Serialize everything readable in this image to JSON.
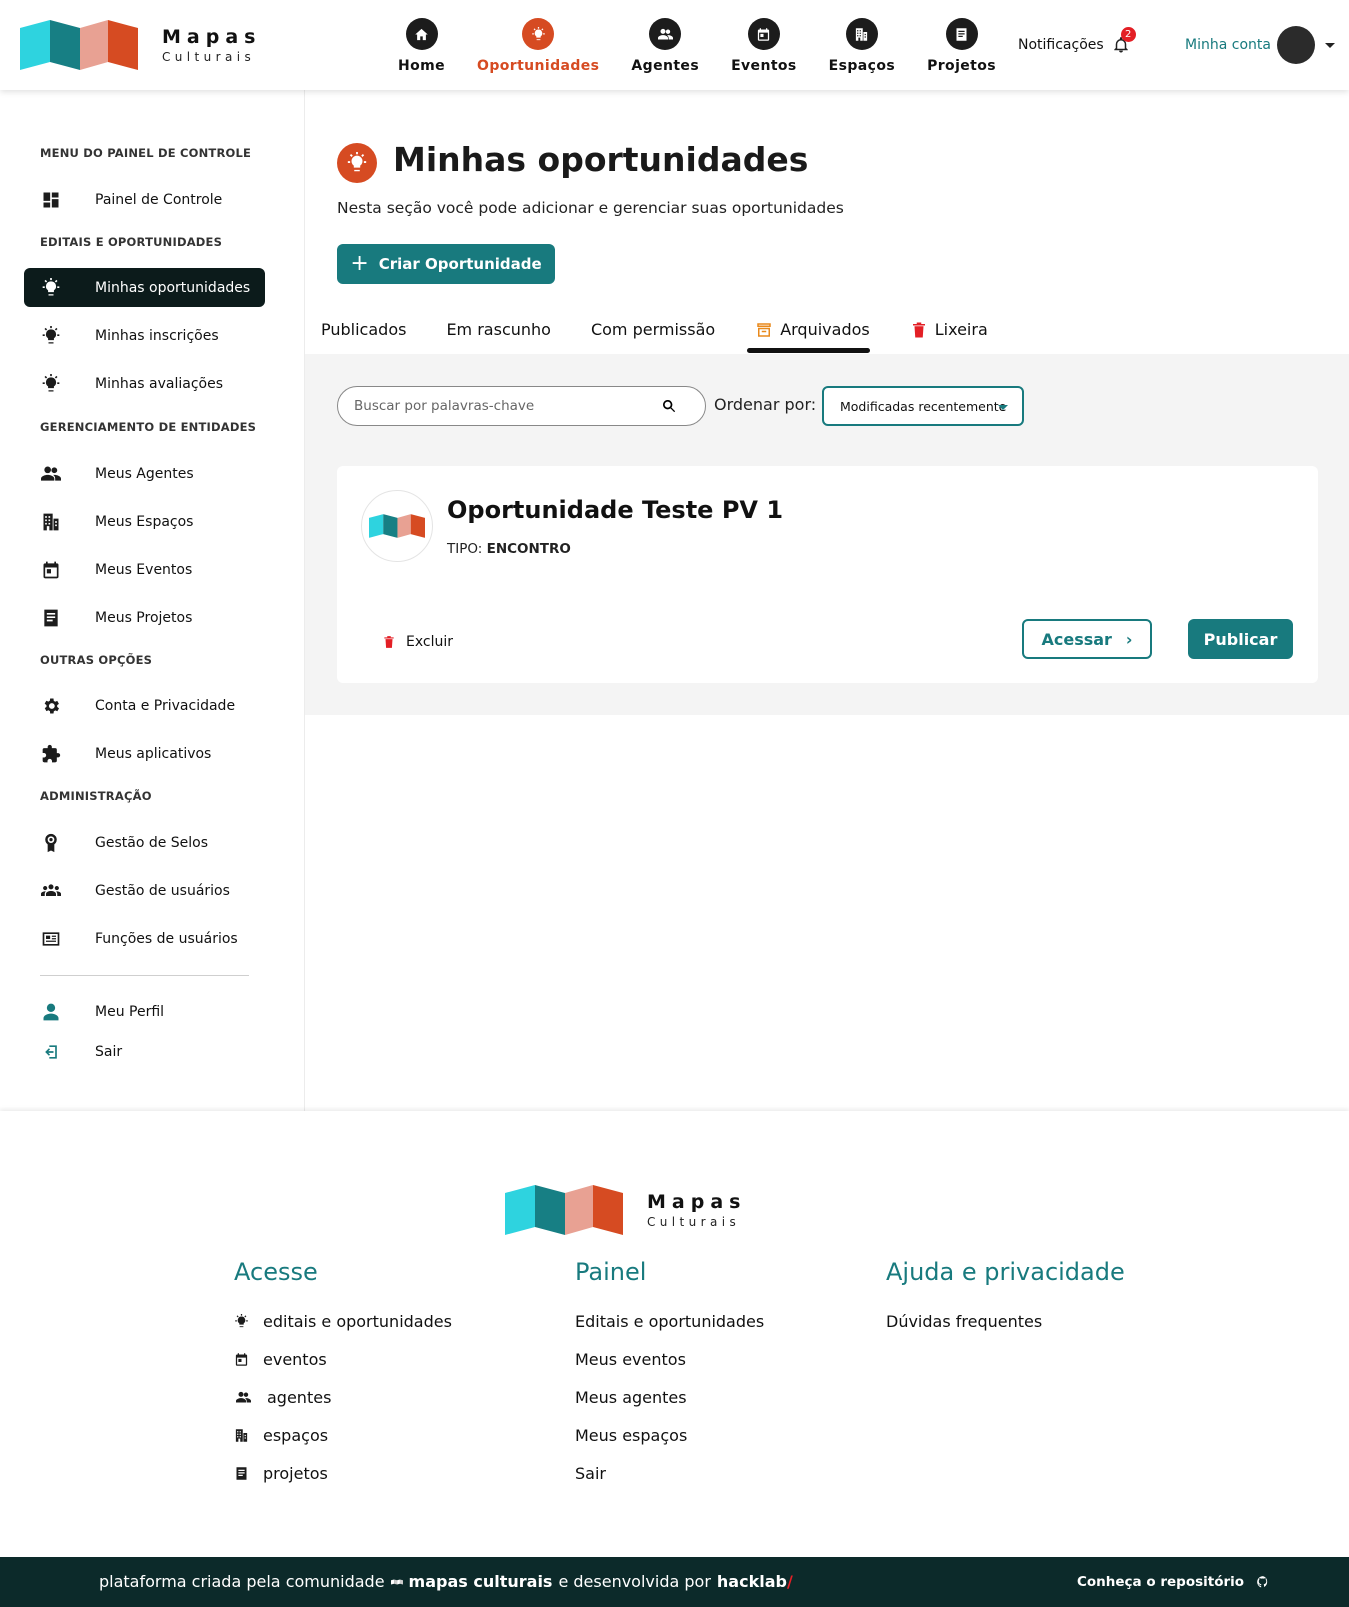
{
  "brand": {
    "title": "Mapas",
    "subtitle": "Culturais"
  },
  "colors": {
    "accent": "#187a7e",
    "opportunity": "#d64b22",
    "danger": "#e31f25",
    "footer_bar": "#0c2a2a"
  },
  "topnav": [
    {
      "label": "Home",
      "icon": "home-icon"
    },
    {
      "label": "Oportunidades",
      "icon": "lightbulb-icon",
      "active": true
    },
    {
      "label": "Agentes",
      "icon": "people-icon"
    },
    {
      "label": "Eventos",
      "icon": "calendar-icon"
    },
    {
      "label": "Espaços",
      "icon": "building-icon"
    },
    {
      "label": "Projetos",
      "icon": "document-icon"
    }
  ],
  "header": {
    "notifications_label": "Notificações",
    "notifications_count": "2",
    "account_label": "Minha conta"
  },
  "sidebar": {
    "groups": {
      "panel": "MENU DO PAINEL DE CONTROLE",
      "editais": "EDITAIS E OPORTUNIDADES",
      "entidades": "GERENCIAMENTO DE ENTIDADES",
      "outras": "OUTRAS OPÇÕES",
      "admin": "ADMINISTRAÇÃO"
    },
    "items": {
      "painel": "Painel de Controle",
      "oportunidades": "Minhas oportunidades",
      "inscricoes": "Minhas inscrições",
      "avaliacoes": "Minhas avaliações",
      "agentes": "Meus Agentes",
      "espacos": "Meus Espaços",
      "eventos": "Meus Eventos",
      "projetos": "Meus Projetos",
      "conta": "Conta e Privacidade",
      "aplicativos": "Meus aplicativos",
      "selos": "Gestão de Selos",
      "usuarios": "Gestão de usuários",
      "funcoes": "Funções de usuários",
      "perfil": "Meu Perfil",
      "sair": "Sair"
    }
  },
  "main": {
    "title": "Minhas oportunidades",
    "description": "Nesta seção você pode adicionar e gerenciar suas oportunidades",
    "create_button": "Criar Oportunidade",
    "tabs": {
      "publicados": "Publicados",
      "rascunho": "Em rascunho",
      "permissao": "Com permissão",
      "arquivados": "Arquivados",
      "lixeira": "Lixeira"
    },
    "search_placeholder": "Buscar por palavras-chave",
    "sort_label": "Ordenar por:",
    "sort_value": "Modificadas recentemente"
  },
  "card": {
    "title": "Oportunidade Teste PV 1",
    "type_label": "TIPO:",
    "type_value": "ENCONTRO",
    "delete_label": "Excluir",
    "access_label": "Acessar",
    "publish_label": "Publicar"
  },
  "footer": {
    "acesse": {
      "title": "Acesse",
      "links": [
        "editais e oportunidades",
        "eventos",
        "agentes",
        "espaços",
        "projetos"
      ]
    },
    "painel": {
      "title": "Painel",
      "links": [
        "Editais e oportunidades",
        "Meus eventos",
        "Meus agentes",
        "Meus espaços",
        "Sair"
      ]
    },
    "ajuda": {
      "title": "Ajuda e privacidade",
      "links": [
        "Dúvidas frequentes"
      ]
    },
    "bar": {
      "prefix": "plataforma criada pela comunidade",
      "community": "mapas culturais",
      "middle": "e desenvolvida por",
      "company": "hacklab",
      "slash": "/",
      "repo": "Conheça o repositório"
    }
  }
}
